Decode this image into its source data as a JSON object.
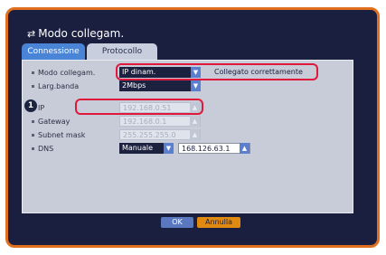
{
  "window": {
    "title": "Modo collegam."
  },
  "tabs": [
    {
      "label": "Connessione"
    },
    {
      "label": "Protocollo"
    }
  ],
  "settings": {
    "mode_label": "Modo collegam.",
    "mode_value": "IP dinam.",
    "status": "Collegato correttamente",
    "bandwidth_label": "Larg.banda",
    "bandwidth_value": "2Mbps",
    "ip_label": "IP",
    "ip_value": "192.168.0.51",
    "gateway_label": "Gateway",
    "gateway_value": "192.168.0.1",
    "subnet_label": "Subnet mask",
    "subnet_value": "255.255.255.0",
    "dns_label": "DNS",
    "dns_mode_value": "Manuale",
    "dns_value": "168.126.63.1"
  },
  "annotation": {
    "badge": "1"
  },
  "buttons": {
    "ok": "OK",
    "cancel": "Annulla"
  },
  "icons": {
    "title_icon": "network-icon",
    "dropdown_icon": "arrow-down-icon"
  }
}
